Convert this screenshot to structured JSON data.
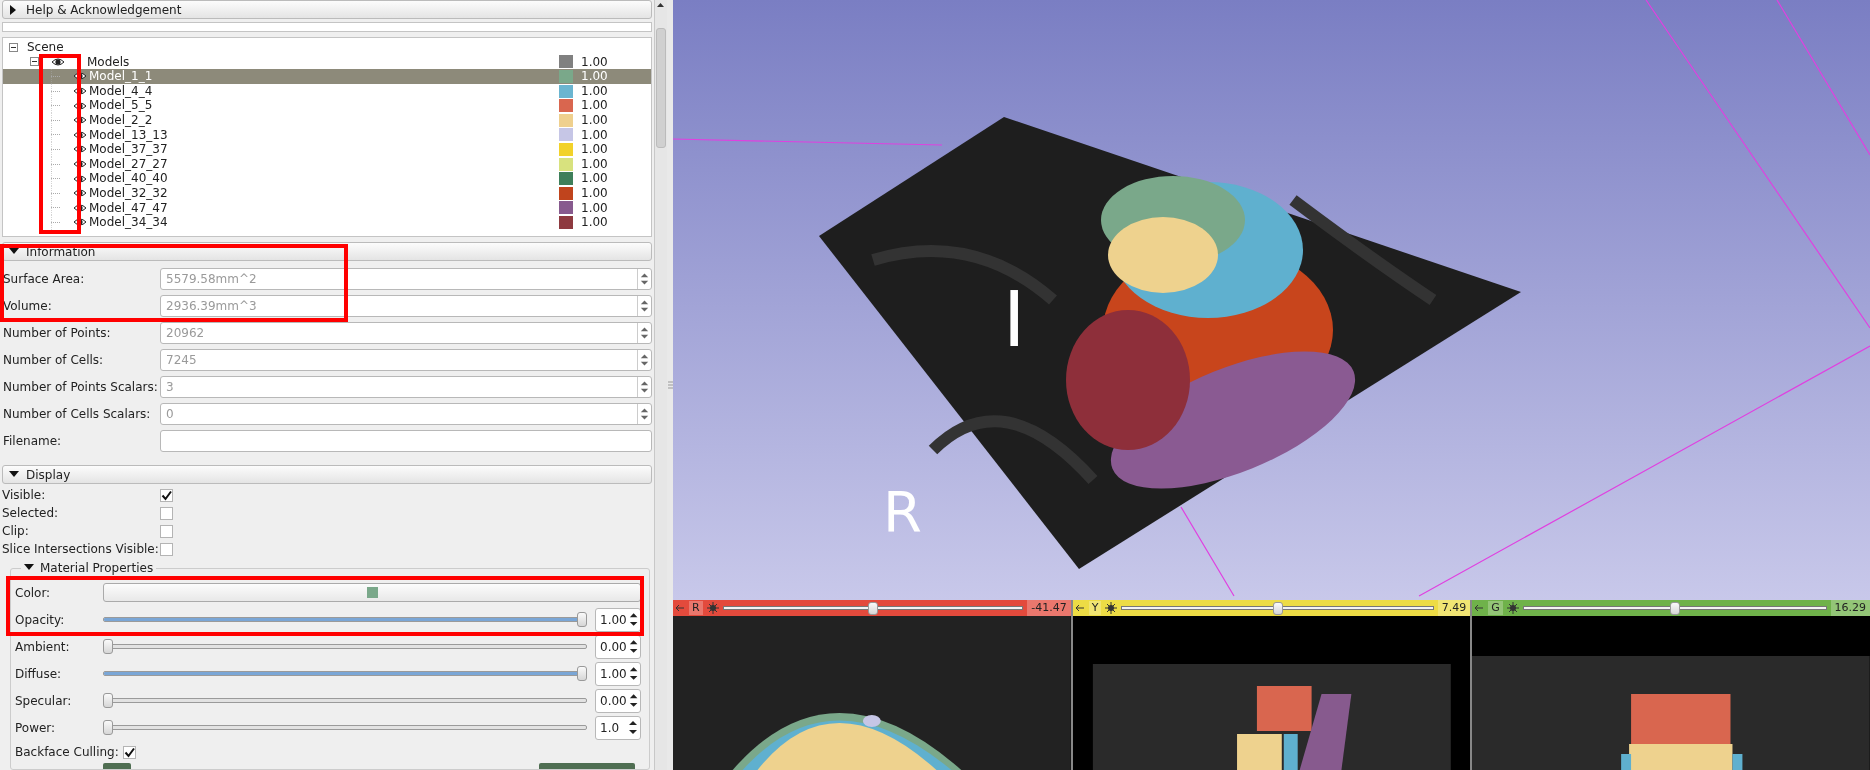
{
  "help_section": {
    "title": "Help & Acknowledgement",
    "expanded": false
  },
  "scene_tree": {
    "label": "Scene",
    "expanded": true,
    "children": [
      {
        "label": "Models",
        "visible": true,
        "expanded": true,
        "selected": false,
        "color": "#808080",
        "opacity": "1.00",
        "children": [
          {
            "label": "Model_1_1",
            "visible": true,
            "selected": true,
            "color": "#7aa88a",
            "opacity": "1.00"
          },
          {
            "label": "Model_4_4",
            "visible": true,
            "selected": false,
            "color": "#6bb5d0",
            "opacity": "1.00"
          },
          {
            "label": "Model_5_5",
            "visible": true,
            "selected": false,
            "color": "#d9664f",
            "opacity": "1.00"
          },
          {
            "label": "Model_2_2",
            "visible": true,
            "selected": false,
            "color": "#efd08e",
            "opacity": "1.00"
          },
          {
            "label": "Model_13_13",
            "visible": true,
            "selected": false,
            "color": "#c6c6e6",
            "opacity": "1.00"
          },
          {
            "label": "Model_37_37",
            "visible": true,
            "selected": false,
            "color": "#f2d22a",
            "opacity": "1.00"
          },
          {
            "label": "Model_27_27",
            "visible": true,
            "selected": false,
            "color": "#d8e27e",
            "opacity": "1.00"
          },
          {
            "label": "Model_40_40",
            "visible": true,
            "selected": false,
            "color": "#3e7f5a",
            "opacity": "1.00"
          },
          {
            "label": "Model_32_32",
            "visible": true,
            "selected": false,
            "color": "#c0441d",
            "opacity": "1.00"
          },
          {
            "label": "Model_47_47",
            "visible": true,
            "selected": false,
            "color": "#875a8e",
            "opacity": "1.00"
          },
          {
            "label": "Model_34_34",
            "visible": true,
            "selected": false,
            "color": "#8e3a40",
            "opacity": "1.00"
          }
        ]
      }
    ]
  },
  "information": {
    "title": "Information",
    "expanded": true,
    "fields": [
      {
        "kind": "spin",
        "label": "Surface Area:",
        "value": "5579.58mm^2",
        "disabled": true
      },
      {
        "kind": "spin",
        "label": "Volume:",
        "value": "2936.39mm^3",
        "disabled": true
      },
      {
        "kind": "spin",
        "label": "Number of Points:",
        "value": "20962",
        "disabled": true
      },
      {
        "kind": "spin",
        "label": "Number of Cells:",
        "value": "7245",
        "disabled": true
      },
      {
        "kind": "spin",
        "label": "Number of Points Scalars:",
        "value": "3",
        "disabled": true
      },
      {
        "kind": "spin",
        "label": "Number of Cells Scalars:",
        "value": "0",
        "disabled": true
      },
      {
        "kind": "text",
        "label": "Filename:"
      }
    ]
  },
  "display": {
    "title": "Display",
    "expanded": true,
    "checkboxes": [
      {
        "label": "Visible:",
        "checked": true
      },
      {
        "label": "Selected:",
        "checked": false
      },
      {
        "label": "Clip:",
        "checked": false
      },
      {
        "label": "Slice Intersections Visible:",
        "checked": false
      }
    ],
    "material": {
      "title": "Material Properties",
      "expanded": true,
      "color": {
        "label": "Color:",
        "color": "#7aa88a"
      },
      "sliders": [
        {
          "label": "Opacity:",
          "level": 1,
          "value": "1.00"
        },
        {
          "label": "Ambient:",
          "level": 0,
          "value": "0.00"
        },
        {
          "label": "Diffuse:",
          "level": 1,
          "value": "1.00"
        },
        {
          "label": "Specular:",
          "level": 0,
          "value": "0.00"
        },
        {
          "label": "Power:",
          "level": 0,
          "value": "1.0"
        }
      ],
      "backface_culling": {
        "label": "Backface Culling:",
        "checked": true
      }
    }
  },
  "view_3d": {
    "orientation_labels": [
      "I",
      "R"
    ]
  },
  "slice_views": [
    {
      "letter": "R",
      "color": "#e34a3c",
      "level": 0.5,
      "value": "-41.47"
    },
    {
      "letter": "Y",
      "color": "#eddc45",
      "level": 0.5,
      "value": "7.49"
    },
    {
      "letter": "G",
      "color": "#6fb24a",
      "level": 0.5,
      "value": "16.29"
    }
  ]
}
